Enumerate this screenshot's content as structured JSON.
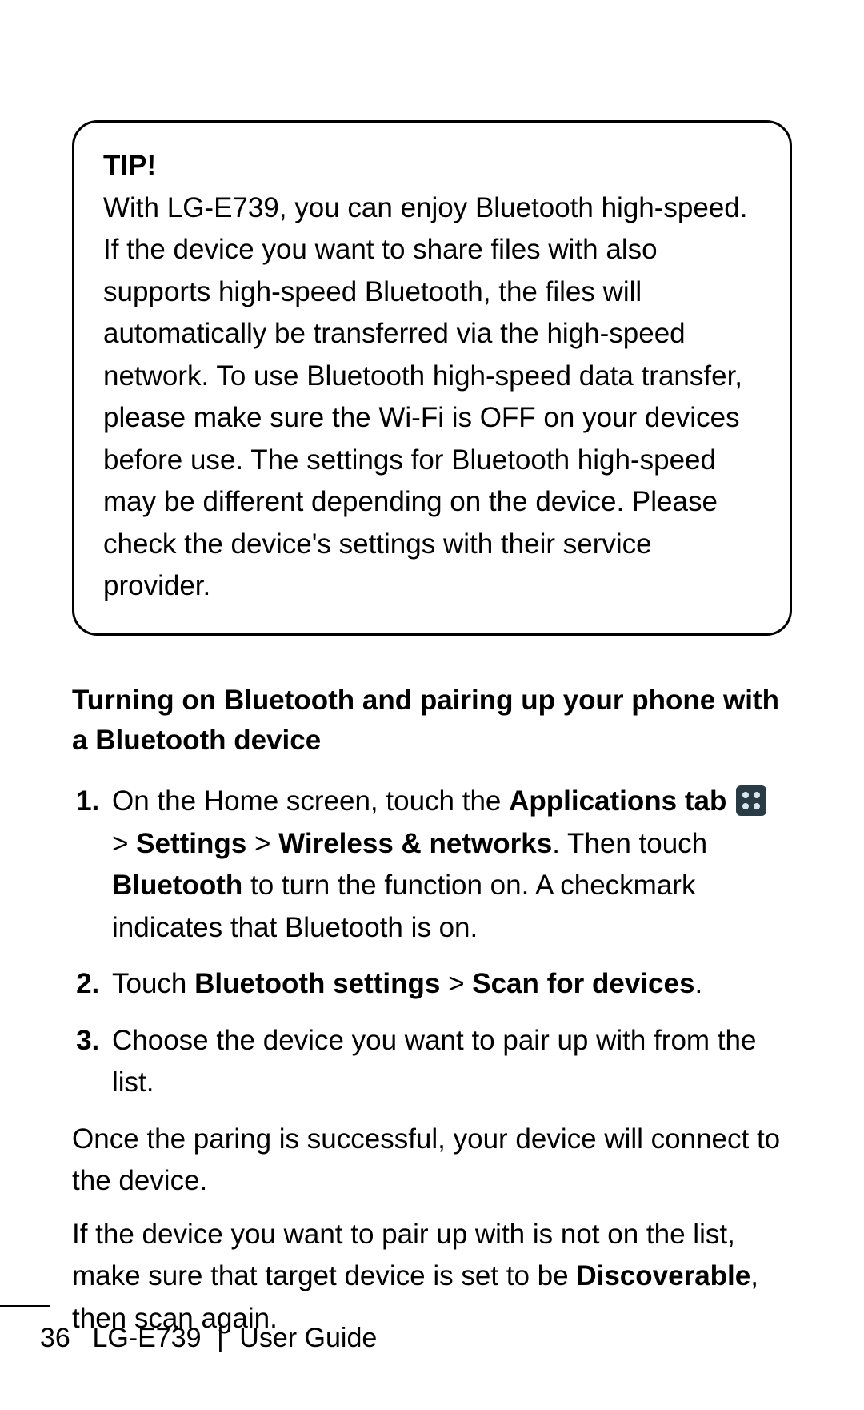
{
  "tip": {
    "title": "TIP!",
    "p1": "With LG-E739, you can enjoy Bluetooth high-speed.",
    "p2": "If the device you want to share files with also supports high-speed Bluetooth, the files will automatically be transferred via the high-speed network. To use Bluetooth high-speed data transfer, please make sure the Wi-Fi is OFF on your devices before use. The settings for Bluetooth high-speed may be different depending on the device. Please check the device's settings with their service provider."
  },
  "section": {
    "heading": "Turning on Bluetooth and pairing up your phone with a Bluetooth device",
    "step1": {
      "pre": "On the Home screen, touch the ",
      "apps_tab": "Applications tab",
      "arrow1": " > ",
      "settings": "Settings",
      "arrow2": " > ",
      "wireless": "Wireless & networks",
      "post1": ". Then touch ",
      "bluetooth": "Bluetooth",
      "post2": " to turn the function on. A checkmark indicates that Bluetooth is on."
    },
    "step2": {
      "pre": "Touch ",
      "bt_settings": "Bluetooth settings",
      "arrow": " > ",
      "scan": "Scan for devices",
      "post": "."
    },
    "step3": "Choose the device you want to pair up with from the list.",
    "para1": "Once the paring is successful, your device will connect to the device.",
    "para2_pre": "If the device you want to pair up with is not on the list, make sure that target device is set to be ",
    "para2_bold": "Discoverable",
    "para2_post": ", then scan again."
  },
  "footer": {
    "page_num": "36",
    "model": "LG-E739",
    "sep": "|",
    "guide": "User Guide"
  }
}
